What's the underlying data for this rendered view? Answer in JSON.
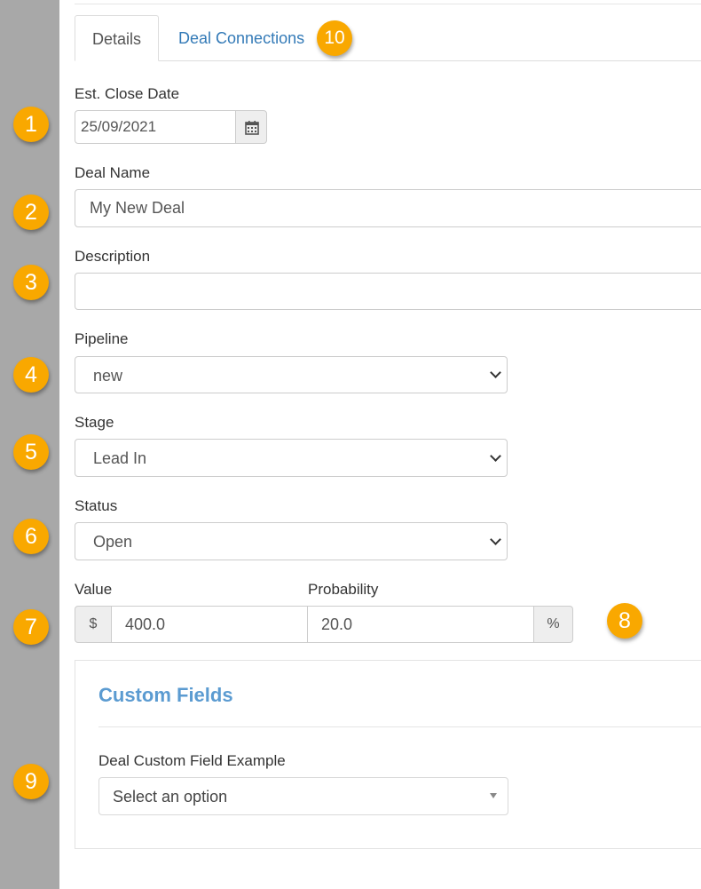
{
  "tabs": [
    {
      "label": "Details"
    },
    {
      "label": "Deal Connections"
    }
  ],
  "form": {
    "close_date": {
      "label": "Est. Close Date",
      "value": "25/09/2021",
      "icon": "calendar-icon"
    },
    "deal_name": {
      "label": "Deal Name",
      "value": "My New Deal"
    },
    "description": {
      "label": "Description",
      "value": ""
    },
    "pipeline": {
      "label": "Pipeline",
      "value": "new"
    },
    "stage": {
      "label": "Stage",
      "value": "Lead In"
    },
    "status": {
      "label": "Status",
      "value": "Open"
    },
    "value": {
      "label": "Value",
      "prefix": "$",
      "value": "400.0"
    },
    "probability": {
      "label": "Probability",
      "value": "20.0",
      "suffix": "%"
    }
  },
  "custom_fields": {
    "title": "Custom Fields",
    "field_label": "Deal Custom Field Example",
    "placeholder": "Select an option"
  },
  "badges": [
    "1",
    "2",
    "3",
    "4",
    "5",
    "6",
    "7",
    "8",
    "9",
    "10"
  ],
  "colors": {
    "badge": "#f9a800",
    "link": "#337ab7",
    "panel_title": "#5b9bd1",
    "sidebar": "#a8a8a8"
  }
}
